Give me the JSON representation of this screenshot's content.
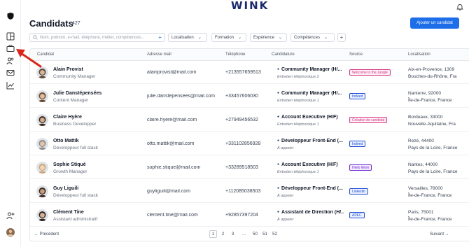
{
  "app": {
    "logo": "WINK"
  },
  "header": {
    "title": "Candidats",
    "count": "427",
    "add_button": "Ajouter un candidat"
  },
  "filters": {
    "search_placeholder": "Nom, prénom, e-mail, téléphone, métier, compétences...",
    "items": [
      "Localisation",
      "Formation",
      "Expérience",
      "Compétences"
    ]
  },
  "columns": [
    "Candidat",
    "Adresse mail",
    "Téléphone",
    "Candidature",
    "Source",
    "Localisation"
  ],
  "rows": [
    {
      "name": "Alain Provist",
      "job": "Community Manager",
      "email": "alainprovist@mail.com",
      "phone": "+213557659513",
      "candidature": "Community Manager (H/...",
      "step": "Entretien téléphonique 2",
      "source": "Welcome to the Jungle",
      "source_color": "#d63384",
      "loc1": "Aix-en-Provence, 1309",
      "loc2": "Bouches-du-Rhône, Fra"
    },
    {
      "name": "Julie Danstépensées",
      "job": "Content Manager",
      "email": "julie.danstepensees@mail.com",
      "phone": "+33457606030",
      "candidature": "Community Manager (H/...",
      "step": "Entretien téléphonique 1",
      "source": "Indeed",
      "source_color": "#1d4ed8",
      "loc1": "Nanterre, 92000",
      "loc2": "Île-de-France, France"
    },
    {
      "name": "Claire Hyère",
      "job": "Business Developper",
      "email": "claire.hyere@mail.com",
      "phone": "+27949456532",
      "candidature": "Account Executive (H/F)",
      "step": "Entretien téléphonique 1",
      "source": "Création de candidat",
      "source_color": "#d63384",
      "loc1": "Bordeaux, 33000",
      "loc2": "Nouvelle-Aquitaine, Fra"
    },
    {
      "name": "Otto Mattik",
      "job": "Développeur full stack",
      "email": "otto.mattik@mail.com",
      "phone": "+331102856928",
      "candidature": "Développeur Front-End (...",
      "step": "À appeler",
      "source": "Indeed",
      "source_color": "#1d4ed8",
      "loc1": "Rezé, 44400",
      "loc2": "Pays de la Loire, France"
    },
    {
      "name": "Sophie Stiqué",
      "job": "Growth Manager",
      "email": "sophie.stique@mail.com",
      "phone": "+33289518503",
      "candidature": "Account Executive (H/F)",
      "step": "Entretien téléphonique 1",
      "source": "Hello Work",
      "source_color": "#6d28d9",
      "loc1": "Nantes, 44000",
      "loc2": "Pays de la Loire, France"
    },
    {
      "name": "Guy Liguili",
      "job": "Développeur full stack",
      "email": "guyliguili@mail.com",
      "phone": "+112085038503",
      "candidature": "Développeur Front-End (...",
      "step": "À appeler",
      "source": "Linkedin",
      "source_color": "#1d4ed8",
      "loc1": "Versailles, 78000",
      "loc2": "Île-de-France, France"
    },
    {
      "name": "Clément Tine",
      "job": "Assistant administratif",
      "email": "clement.tine@mail.com",
      "phone": "+92857397204",
      "candidature": "Assistant de Direction (H/...",
      "step": "À appeler",
      "source": "APEC",
      "source_color": "#1d4ed8",
      "loc1": "Paris, 75001",
      "loc2": "Île-de-France, France"
    }
  ],
  "pagination": {
    "prev": "← Précédent",
    "next": "Suivant →",
    "pages": [
      "1",
      "2",
      "3",
      "...",
      "50",
      "51",
      "52"
    ],
    "active": "1"
  }
}
